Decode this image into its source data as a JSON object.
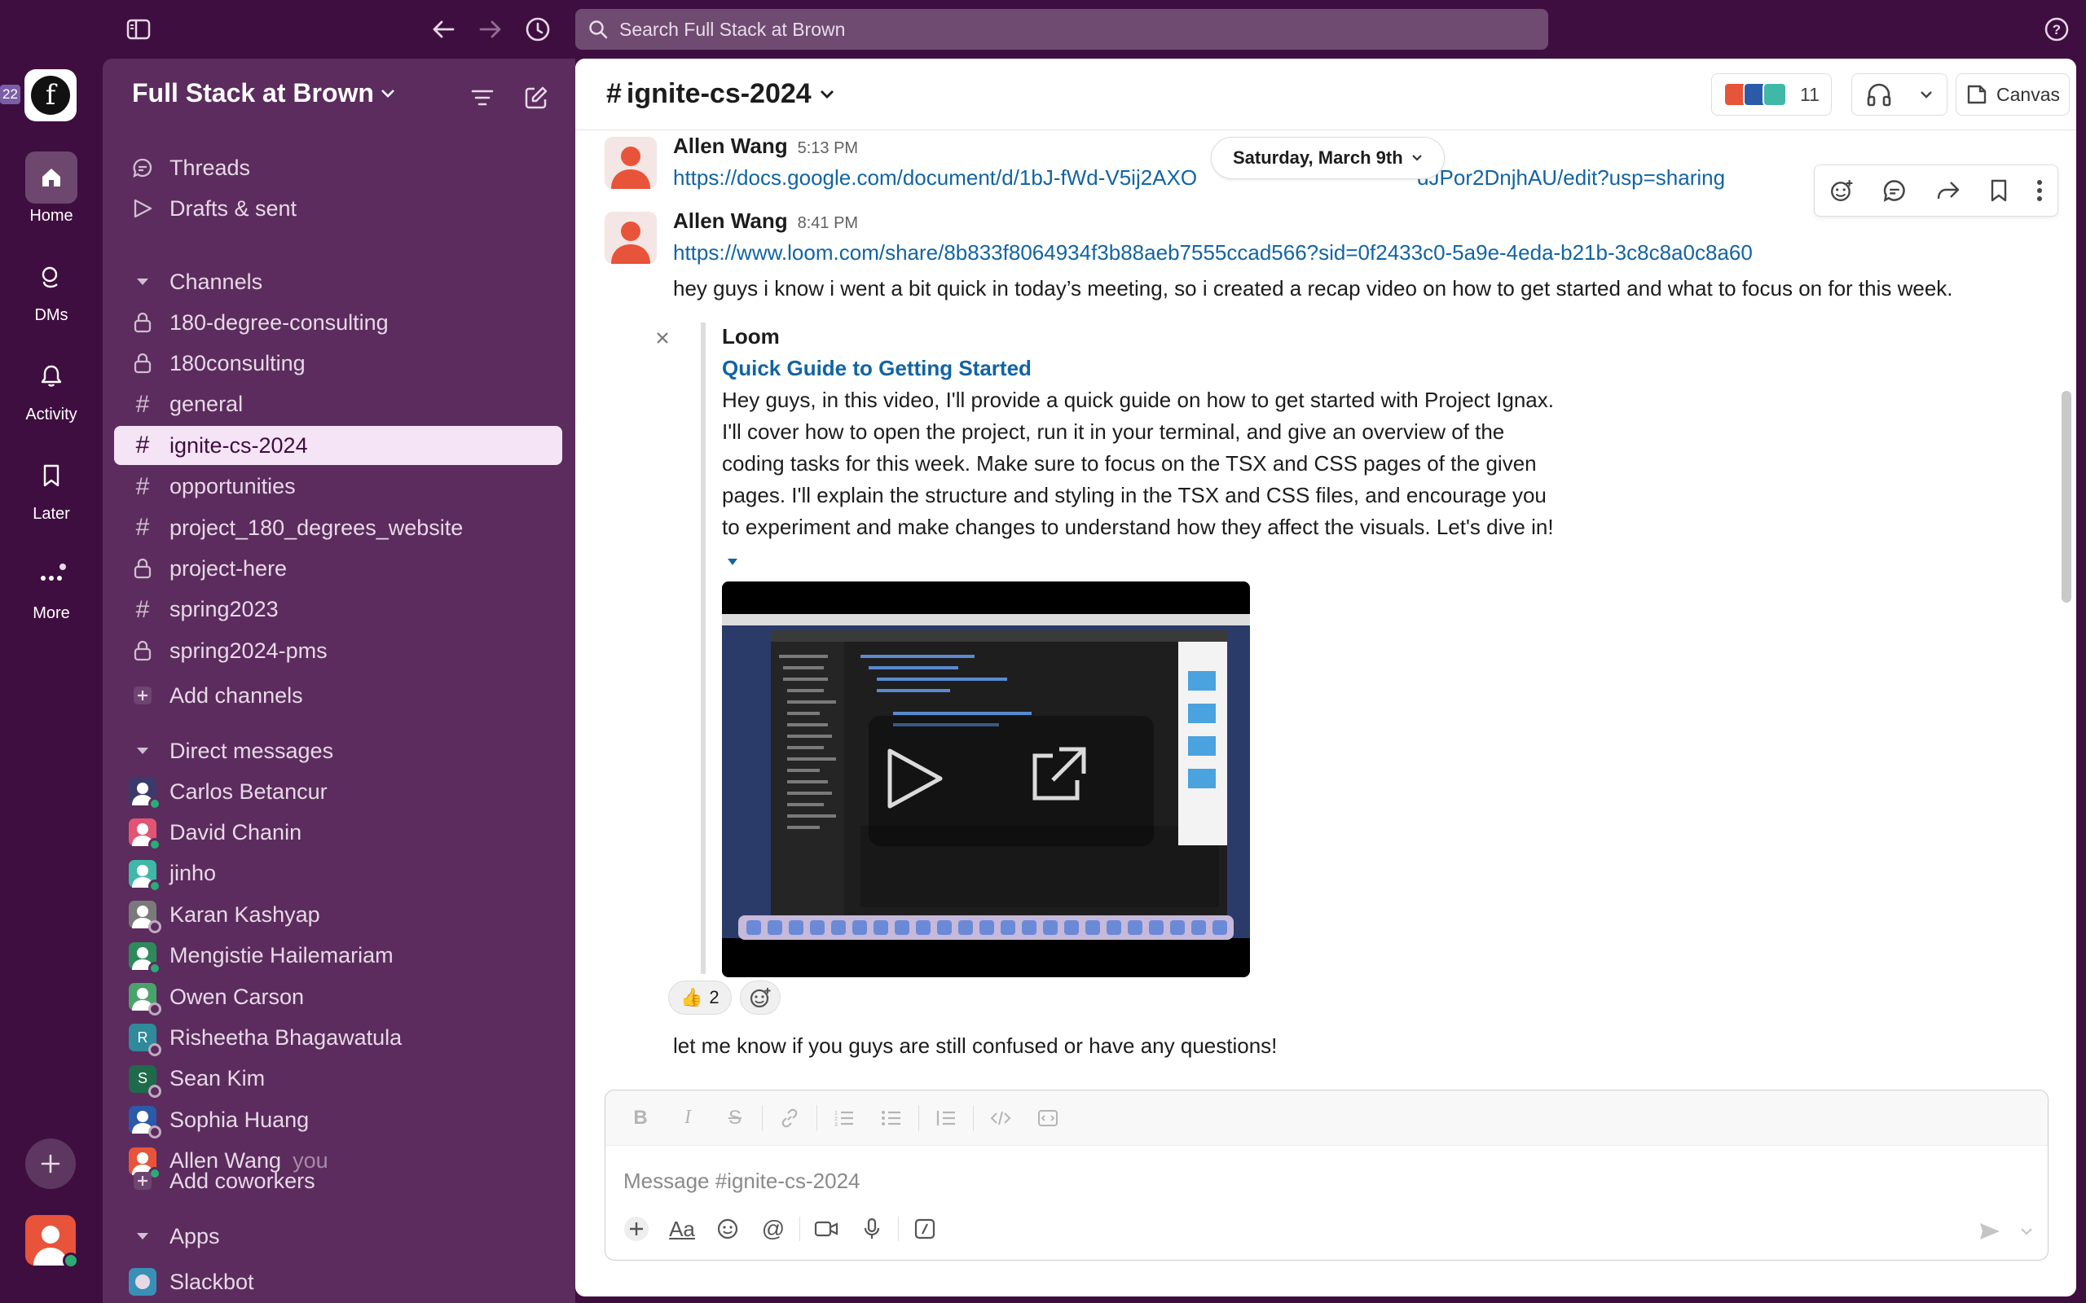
{
  "topbar": {
    "search_placeholder": "Search Full Stack at Brown"
  },
  "rail": {
    "workspace_badge": "22",
    "workspace_letter": "f",
    "items": [
      {
        "label": "Home",
        "icon": "home-icon"
      },
      {
        "label": "DMs",
        "icon": "dms-icon"
      },
      {
        "label": "Activity",
        "icon": "bell-icon"
      },
      {
        "label": "Later",
        "icon": "bookmark-icon"
      },
      {
        "label": "More",
        "icon": "more-icon"
      }
    ]
  },
  "sidebar": {
    "workspace_name": "Full Stack at Brown",
    "threads": "Threads",
    "drafts": "Drafts & sent",
    "channels_header": "Channels",
    "channels": [
      {
        "name": "180-degree-consulting",
        "private": true
      },
      {
        "name": "180consulting",
        "private": true
      },
      {
        "name": "general",
        "private": false
      },
      {
        "name": "ignite-cs-2024",
        "private": false,
        "active": true
      },
      {
        "name": "opportunities",
        "private": false
      },
      {
        "name": "project_180_degrees_website",
        "private": false
      },
      {
        "name": "project-here",
        "private": true
      },
      {
        "name": "spring2023",
        "private": false
      },
      {
        "name": "spring2024-pms",
        "private": true
      }
    ],
    "add_channels": "Add channels",
    "dm_header": "Direct messages",
    "dms": [
      {
        "name": "Carlos Betancur",
        "color": "#3b3b6b",
        "letter": ""
      },
      {
        "name": "David Chanin",
        "color": "#e25572",
        "letter": ""
      },
      {
        "name": "jinho",
        "color": "#3fb8a8",
        "letter": ""
      },
      {
        "name": "Karan Kashyap",
        "color": "#7a7a7a",
        "letter": ""
      },
      {
        "name": "Mengistie Hailemariam",
        "color": "#2e8a5a",
        "letter": ""
      },
      {
        "name": "Owen Carson",
        "color": "#4aa36a",
        "letter": ""
      },
      {
        "name": "Risheetha Bhagawatula",
        "color": "#2f8a9a",
        "letter": "R"
      },
      {
        "name": "Sean Kim",
        "color": "#1f6a4a",
        "letter": "S"
      },
      {
        "name": "Sophia Huang",
        "color": "#2a5aa8",
        "letter": ""
      },
      {
        "name": "Allen Wang",
        "color": "#e8543a",
        "letter": "",
        "you": "you"
      }
    ],
    "add_coworkers": "Add coworkers",
    "apps_header": "Apps",
    "apps": [
      {
        "name": "Slackbot"
      }
    ]
  },
  "channel": {
    "name": "ignite-cs-2024",
    "member_count": "11",
    "canvas_label": "Canvas"
  },
  "messages": [
    {
      "author": "Allen Wang",
      "time": "5:13 PM",
      "link": "https://docs.google.com/document/d/1bJ-fWd-V5ij2AXO",
      "link_tail": "dJPor2DnjhAU/edit?usp=sharing"
    },
    {
      "author": "Allen Wang",
      "time": "8:41 PM",
      "link": "https://www.loom.com/share/8b833f8064934f3b88aeb7555ccad566?sid=0f2433c0-5a9e-4eda-b21b-3c8c8a0c8a60",
      "text": "hey guys i know i went a bit quick in today’s meeting, so i created a recap video on how to get started and what to focus on for this week.",
      "attachment": {
        "source": "Loom",
        "title": "Quick Guide to Getting Started",
        "description": "Hey guys, in this video, I'll provide a quick guide on how to get started with Project Ignax. I'll cover how to open the project, run it in your terminal, and give an overview of the coding tasks for this week. Make sure to focus on the TSX and CSS pages of the given pages. I'll explain the structure and styling in the TSX and CSS files, and encourage you to experiment and make changes to understand how they affect the visuals. Let's dive in!"
      },
      "reaction": {
        "emoji": "👍",
        "count": "2"
      },
      "followup": "let me know if you guys are still confused or have any questions!"
    }
  ],
  "date_divider": "Saturday, March 9th",
  "composer": {
    "placeholder": "Message #ignite-cs-2024"
  }
}
